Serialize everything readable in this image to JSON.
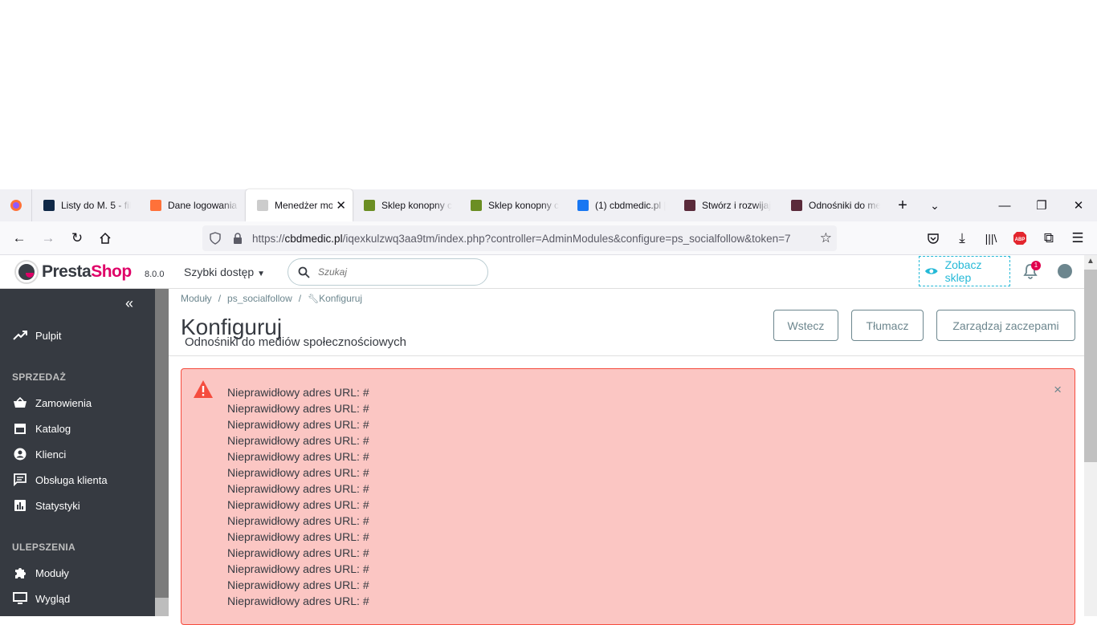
{
  "browser": {
    "tabs": [
      {
        "label": "Listy do M. 5 - fil",
        "color": "#0f2847"
      },
      {
        "label": "Dane logowania i",
        "color": "#ff7139"
      },
      {
        "label": "Menedżer mo",
        "color": "#cccccc",
        "active": true
      },
      {
        "label": "Sklep konopny c",
        "color": "#6b8e23"
      },
      {
        "label": "Sklep konopny c",
        "color": "#6b8e23"
      },
      {
        "label": "(1) cbdmedic.pl |",
        "color": "#1877f2"
      },
      {
        "label": "Stwórz i rozwijaj",
        "color": "#5a2a3a"
      },
      {
        "label": "Odnośniki do me",
        "color": "#5a2a3a"
      }
    ],
    "url_prefix": "https://",
    "url_domain": "cbdmedic.pl",
    "url_path": "/iqexkulzwq3aa9tm/index.php?controller=AdminModules&configure=ps_socialfollow&token=7"
  },
  "header": {
    "brand_presta": "Presta",
    "brand_shop": "Shop",
    "version": "8.0.0",
    "quick_access": "Szybki dostęp",
    "search_placeholder": "Szukaj",
    "view_shop": "Zobacz sklep",
    "notification_count": "1"
  },
  "sidebar": {
    "dashboard": "Pulpit",
    "section_sales": "SPRZEDAŻ",
    "orders": "Zamowienia",
    "catalog": "Katalog",
    "customers": "Klienci",
    "customer_service": "Obsługa klienta",
    "stats": "Statystyki",
    "section_improve": "ULEPSZENIA",
    "modules": "Moduły",
    "design": "Wygląd"
  },
  "page": {
    "breadcrumb": [
      "Moduły",
      "ps_socialfollow",
      "Konfiguruj"
    ],
    "title": "Konfiguruj",
    "subtitle": "Odnośniki do mediów społecznościowych",
    "buttons": {
      "back": "Wstecz",
      "translate": "Tłumacz",
      "hooks": "Zarządzaj zaczepami"
    }
  },
  "alert": {
    "messages": [
      "Nieprawidłowy adres URL: #",
      "Nieprawidłowy adres URL: #",
      "Nieprawidłowy adres URL: #",
      "Nieprawidłowy adres URL: #",
      "Nieprawidłowy adres URL: #",
      "Nieprawidłowy adres URL: #",
      "Nieprawidłowy adres URL: #",
      "Nieprawidłowy adres URL: #",
      "Nieprawidłowy adres URL: #",
      "Nieprawidłowy adres URL: #",
      "Nieprawidłowy adres URL: #",
      "Nieprawidłowy adres URL: #",
      "Nieprawidłowy adres URL: #",
      "Nieprawidłowy adres URL: #"
    ],
    "close": "×"
  },
  "colors": {
    "accent": "#25b9d7",
    "danger": "#f54c3e",
    "brand_pink": "#df0067",
    "sidebar_bg": "#363a41"
  }
}
